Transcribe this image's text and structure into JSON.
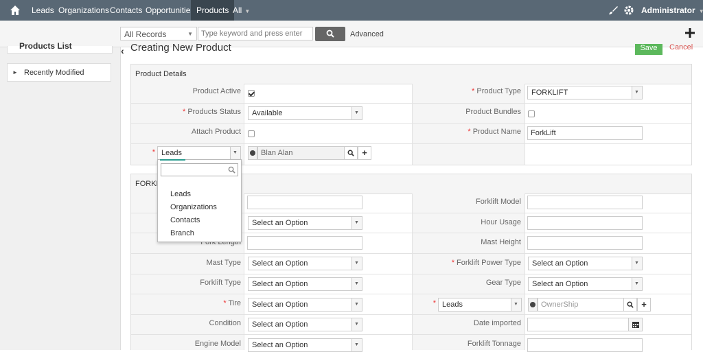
{
  "topnav": {
    "items": [
      "Leads",
      "Organizations",
      "Contacts",
      "Opportunities",
      "Products",
      "All"
    ],
    "active": "Products",
    "user": "Administrator"
  },
  "search": {
    "records_filter": "All Records",
    "placeholder": "Type keyword and press enter",
    "advanced_label": "Advanced"
  },
  "sidebar": {
    "title": "Products List",
    "recent_label": "Recently Modified"
  },
  "page": {
    "title": "Creating New Product",
    "save_label": "Save",
    "cancel_label": "Cancel"
  },
  "product_details": {
    "header": "Product Details",
    "product_active_label": "Product Active",
    "product_type_label": "Product Type",
    "product_type_value": "FORKLIFT",
    "products_status_label": "Products Status",
    "products_status_value": "Available",
    "product_bundles_label": "Product Bundles",
    "attach_product_label": "Attach Product",
    "product_name_label": "Product Name",
    "product_name_value": "ForkLift",
    "related_module_value": "Leads",
    "related_record_value": "Blan Alan"
  },
  "dropdown": {
    "options": [
      "Leads",
      "Organizations",
      "Contacts",
      "Branch"
    ]
  },
  "forklift_block": {
    "header_partial": "FORKLI",
    "forklift_model_label": "Forklift Model",
    "hour_usage_label": "Hour Usage",
    "fork_length_label": "Fork Length",
    "mast_height_label": "Mast Height",
    "mast_type_label": "Mast Type",
    "forklift_power_type_label": "Forklift Power Type",
    "forklift_type_label": "Forklift Type",
    "gear_type_label": "Gear Type",
    "tire_label": "Tire",
    "owner_module_value": "Leads",
    "owner_placeholder": "OwnerShip",
    "condition_label": "Condition",
    "date_imported_label": "Date imported",
    "engine_model_label": "Engine Model",
    "forklift_tonnage_label": "Forklift Tonnage",
    "select_placeholder": "Select an Option"
  }
}
